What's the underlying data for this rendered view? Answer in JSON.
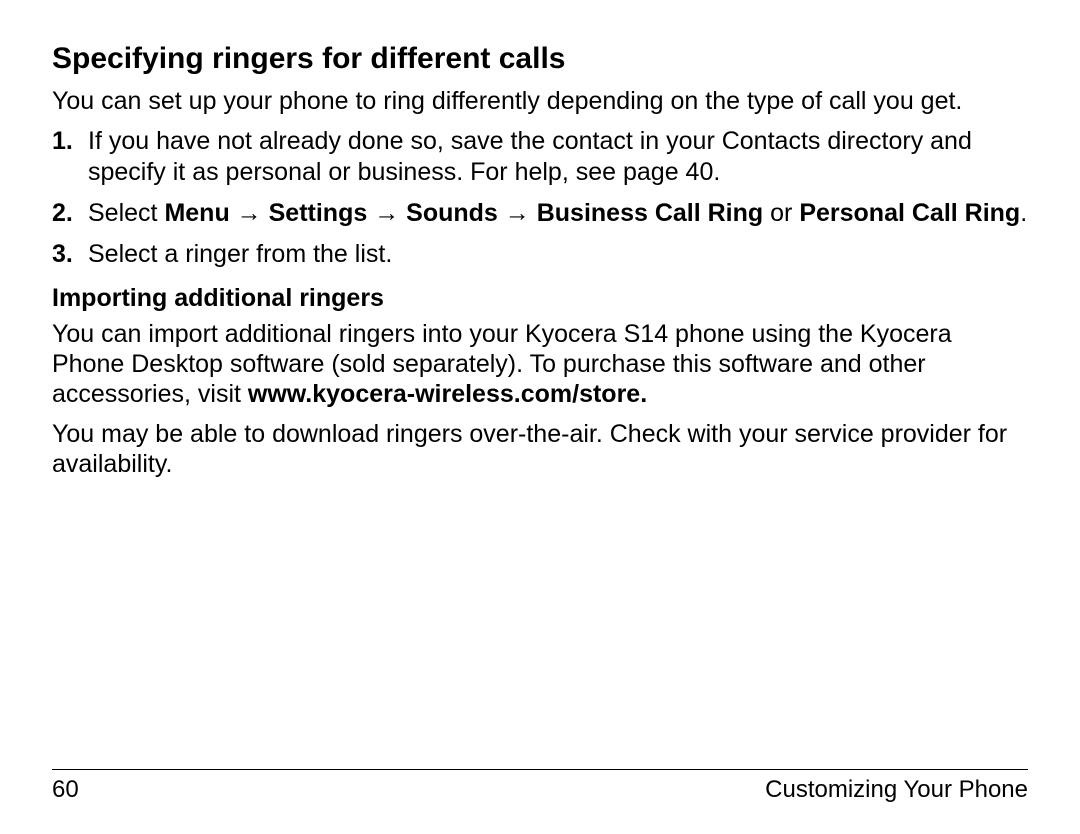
{
  "heading1": "Specifying ringers for different calls",
  "intro": "You can set up your phone to ring differently depending on the type of call you get.",
  "steps": {
    "n1": "1.",
    "s1": "If you have not already done so, save the contact in your Contacts directory and specify it as personal or business. For help, see page 40.",
    "n2": "2.",
    "s2_prefix": "Select ",
    "s2_menu": "Menu",
    "s2_arrow1": " → ",
    "s2_settings": "Settings",
    "s2_arrow2": " → ",
    "s2_sounds": "Sounds",
    "s2_arrow3": " → ",
    "s2_business": "Business Call Ring",
    "s2_or": " or ",
    "s2_personal": "Personal Call Ring",
    "s2_period": ".",
    "n3": "3.",
    "s3": "Select a ringer from the list."
  },
  "heading2": "Importing additional ringers",
  "import_p1_a": "You can import additional ringers into your Kyocera S14 phone using the Kyocera Phone Desktop software (sold separately). To purchase this software and other accessories, visit ",
  "import_p1_url": "www.kyocera-wireless.com/store.",
  "import_p2": "You may be able to download ringers over-the-air. Check with your service provider for availability.",
  "footer": {
    "page": "60",
    "section": "Customizing Your Phone"
  }
}
